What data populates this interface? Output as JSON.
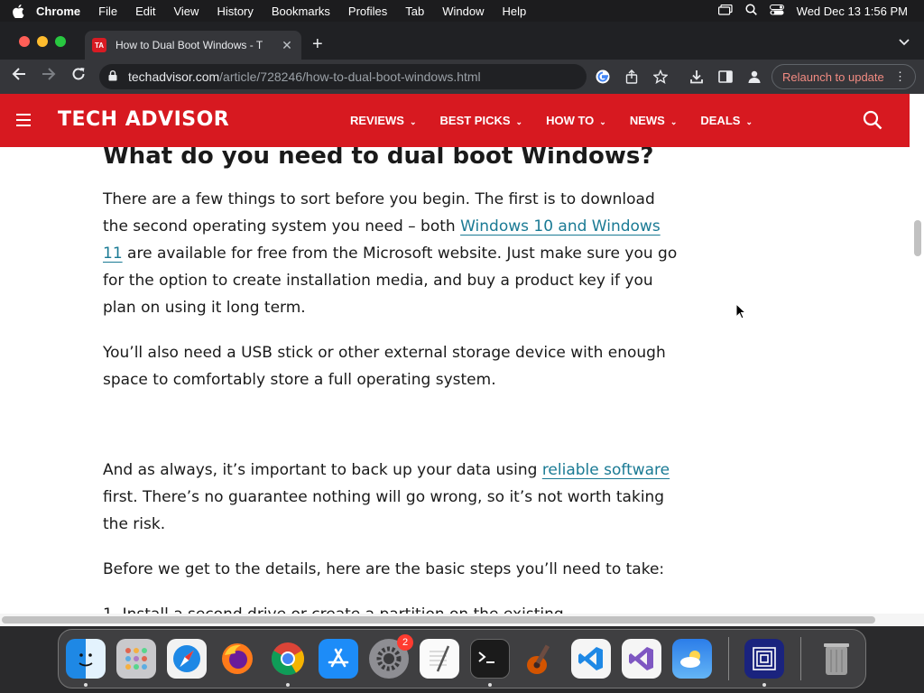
{
  "menubar": {
    "app_name": "Chrome",
    "menus": [
      "File",
      "Edit",
      "View",
      "History",
      "Bookmarks",
      "Profiles",
      "Tab",
      "Window",
      "Help"
    ],
    "datetime": "Wed Dec 13  1:56 PM"
  },
  "browser": {
    "tab_title": "How to Dual Boot Windows - T",
    "tab_favicon": "TA",
    "url_domain": "techadvisor.com",
    "url_path": "/article/728246/how-to-dual-boot-windows.html",
    "relaunch_label": "Relaunch to update"
  },
  "site": {
    "logo": "TECH ADVISOR",
    "nav": [
      "REVIEWS",
      "BEST PICKS",
      "HOW TO",
      "NEWS",
      "DEALS"
    ]
  },
  "article": {
    "heading": "What do you need to dual boot Windows?",
    "p1_before": "There are a few things to sort before you begin. The first is to download the second operating system you need – both ",
    "p1_link": "Windows 10 and Windows 11",
    "p1_after": " are available for free from the Microsoft website. Just make sure you go for the option to create installation media, and buy a product key if you plan on using it long term.",
    "p2": "You’ll also need a USB stick or other external storage device with enough space to comfortably store a full operating system.",
    "p3_before": "And as always, it’s important to back up your data using ",
    "p3_link": "reliable software",
    "p3_after": " first. There’s no guarantee nothing will go wrong, so it’s not worth taking the risk.",
    "p4": "Before we get to the details, here are the basic steps you’ll need to take:",
    "p5_partial": "1. Install a second drive or create a partition on the existing"
  },
  "dock": {
    "apps": [
      "finder-icon",
      "launchpad-icon",
      "safari-icon",
      "firefox-icon",
      "chrome-icon",
      "app-store-icon",
      "system-settings-icon",
      "textedit-icon",
      "terminal-icon",
      "garageband-icon",
      "vscode-icon",
      "visual-studio-icon",
      "weather-icon",
      "screen-icon",
      "trash-icon"
    ],
    "settings_badge": "2"
  },
  "colors": {
    "brand_red": "#d71920",
    "link": "#1a7a94",
    "relaunch": "#f28b82"
  }
}
